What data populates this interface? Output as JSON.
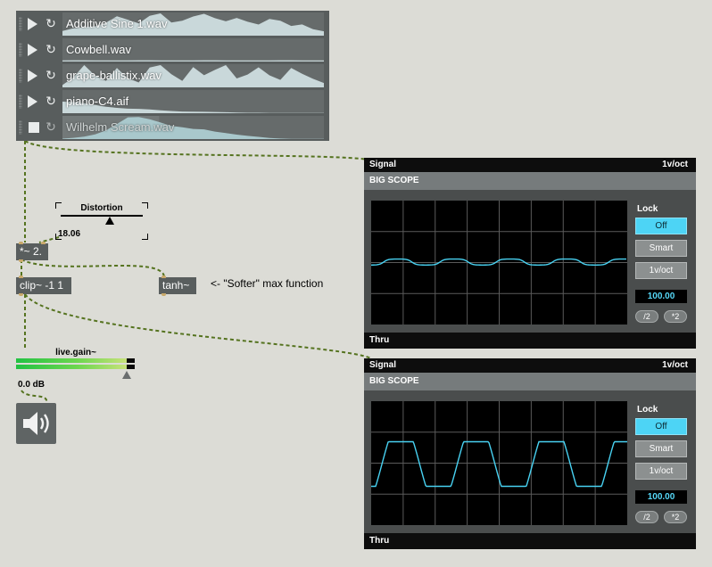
{
  "player": {
    "rows": [
      {
        "state": "play",
        "file": "Additive Sine 1.wav",
        "active": true
      },
      {
        "state": "play",
        "file": "Cowbell.wav",
        "active": true
      },
      {
        "state": "play",
        "file": "grape-ballistix.wav",
        "active": true
      },
      {
        "state": "play",
        "file": "piano-C4.aif",
        "active": true
      },
      {
        "state": "stop",
        "file": "Wilhelm Scream.wav",
        "active": false
      }
    ],
    "loop_glyph": "↻"
  },
  "distortion": {
    "label": "Distortion",
    "value": "18.06"
  },
  "objects": {
    "multiply": "*~ 2.",
    "clip": "clip~ -1 1",
    "tanh": "tanh~"
  },
  "comment": "<- \"Softer\" max function",
  "gain": {
    "label": "live.gain~",
    "value": "0.0 dB"
  },
  "scopes": [
    {
      "top_left": "Signal",
      "top_right": "1v/oct",
      "title": "BIG SCOPE",
      "bottom": "Thru",
      "lock_label": "Lock",
      "buttons": [
        "Off",
        "Smart",
        "1v/oct"
      ],
      "active_button": "Off",
      "number": "100.00",
      "div": "/2",
      "mul": "*2",
      "waveform": "soft"
    },
    {
      "top_left": "Signal",
      "top_right": "1v/oct",
      "title": "BIG SCOPE",
      "bottom": "Thru",
      "lock_label": "Lock",
      "buttons": [
        "Off",
        "Smart",
        "1v/oct"
      ],
      "active_button": "Off",
      "number": "100.00",
      "div": "/2",
      "mul": "*2",
      "waveform": "clipped"
    }
  ],
  "colors": {
    "trace": "#48d2f2",
    "meter_green": "#22c243",
    "cord": "#4d6e2a",
    "accent_button": "#4dd4f5"
  }
}
